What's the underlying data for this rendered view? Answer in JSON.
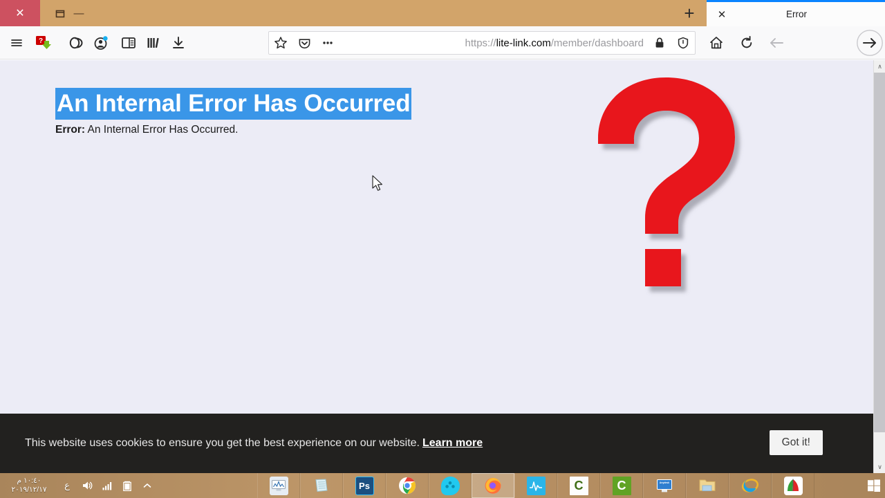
{
  "window": {
    "close_label": "✕",
    "restore_label": "❐",
    "minimize_label": "—",
    "titlebar_color": "#d2a46a",
    "close_button_color": "#cd5160"
  },
  "tabs": {
    "newtab_label": "+",
    "active": {
      "title": "Error",
      "close_label": "✕",
      "accent_color": "#0a84ff"
    }
  },
  "toolbar": {
    "icons": [
      {
        "name": "hamburger-menu-icon",
        "label": "☰"
      },
      {
        "name": "idm-extension-icon",
        "label": "?"
      },
      {
        "name": "link-extension-icon",
        "label": ""
      },
      {
        "name": "account-avatar-icon",
        "label": ""
      },
      {
        "name": "reader-sidebar-icon",
        "label": ""
      },
      {
        "name": "library-icon",
        "label": ""
      },
      {
        "name": "downloads-icon",
        "label": ""
      }
    ],
    "nav": {
      "home_label": "home-icon",
      "reload_label": "reload-icon",
      "back_label": "back-arrow-icon",
      "forward_label": "forward-arrow-icon"
    }
  },
  "address_bar": {
    "scheme": "https://",
    "host": "lite-link.com",
    "path": "/member/dashboard",
    "full_url": "https://lite-link.com/member/dashboard",
    "bookmark_icon": "star-icon",
    "pocket_icon": "pocket-icon",
    "page_actions_icon": "ellipsis-icon",
    "lock_icon": "padlock-icon",
    "tracking_icon": "shield-icon"
  },
  "page": {
    "heading": "An Internal Error Has Occurred",
    "heading_selected": true,
    "selection_color": "#3a96e8",
    "error_prefix": "Error:",
    "error_message": "An Internal Error Has Occurred.",
    "background_color": "#ececf6",
    "graphic": "red-question-mark",
    "graphic_color": "#e8161d"
  },
  "cookie_banner": {
    "message": "This website uses cookies to ensure you get the best experience on our website.",
    "learn_more_label": "Learn more",
    "accept_label": "Got it!",
    "background_color": "#22211f"
  },
  "scrollbar": {
    "up_label": "∧",
    "down_label": "∨"
  },
  "taskbar": {
    "clock": {
      "time": "١٠:٤٠ م",
      "date": "٢٠١٩/١٢/١٧"
    },
    "language_indicator": "ع",
    "tray_icons": [
      {
        "name": "volume-icon"
      },
      {
        "name": "network-signal-icon"
      },
      {
        "name": "battery-icon"
      },
      {
        "name": "show-hidden-icons-icon"
      }
    ],
    "apps": [
      {
        "name": "taskbar-app-system-monitor",
        "label": "",
        "color": "#dfe6ee",
        "active": false
      },
      {
        "name": "taskbar-app-notepad",
        "label": "",
        "color": "#cfe2ea",
        "active": false
      },
      {
        "name": "taskbar-app-photoshop",
        "label": "Ps",
        "color": "#1f6fb5",
        "active": false
      },
      {
        "name": "taskbar-app-chrome",
        "label": "",
        "color": "#ffffff",
        "active": false
      },
      {
        "name": "taskbar-app-media-player",
        "label": "",
        "color": "#2fd0ee",
        "active": false
      },
      {
        "name": "taskbar-app-firefox",
        "label": "",
        "color": "#ff7139",
        "active": true
      },
      {
        "name": "taskbar-app-pulse-monitor",
        "label": "",
        "color": "#29c0f0",
        "active": false
      },
      {
        "name": "taskbar-app-camtasia-editor",
        "label": "C",
        "color": "#ffffff",
        "active": false
      },
      {
        "name": "taskbar-app-camtasia-recorder",
        "label": "C",
        "color": "#5fa324",
        "active": false
      },
      {
        "name": "taskbar-app-remote-desktop",
        "label": "",
        "color": "#2f7fd0",
        "active": false
      },
      {
        "name": "taskbar-app-file-explorer",
        "label": "",
        "color": "#f0c96a",
        "active": false
      },
      {
        "name": "taskbar-app-internet-explorer",
        "label": "e",
        "color": "#ffffff",
        "active": false
      },
      {
        "name": "taskbar-app-download-manager",
        "label": "",
        "color": "#ffffff",
        "active": false
      }
    ],
    "show_desktop_label": "show-desktop"
  }
}
